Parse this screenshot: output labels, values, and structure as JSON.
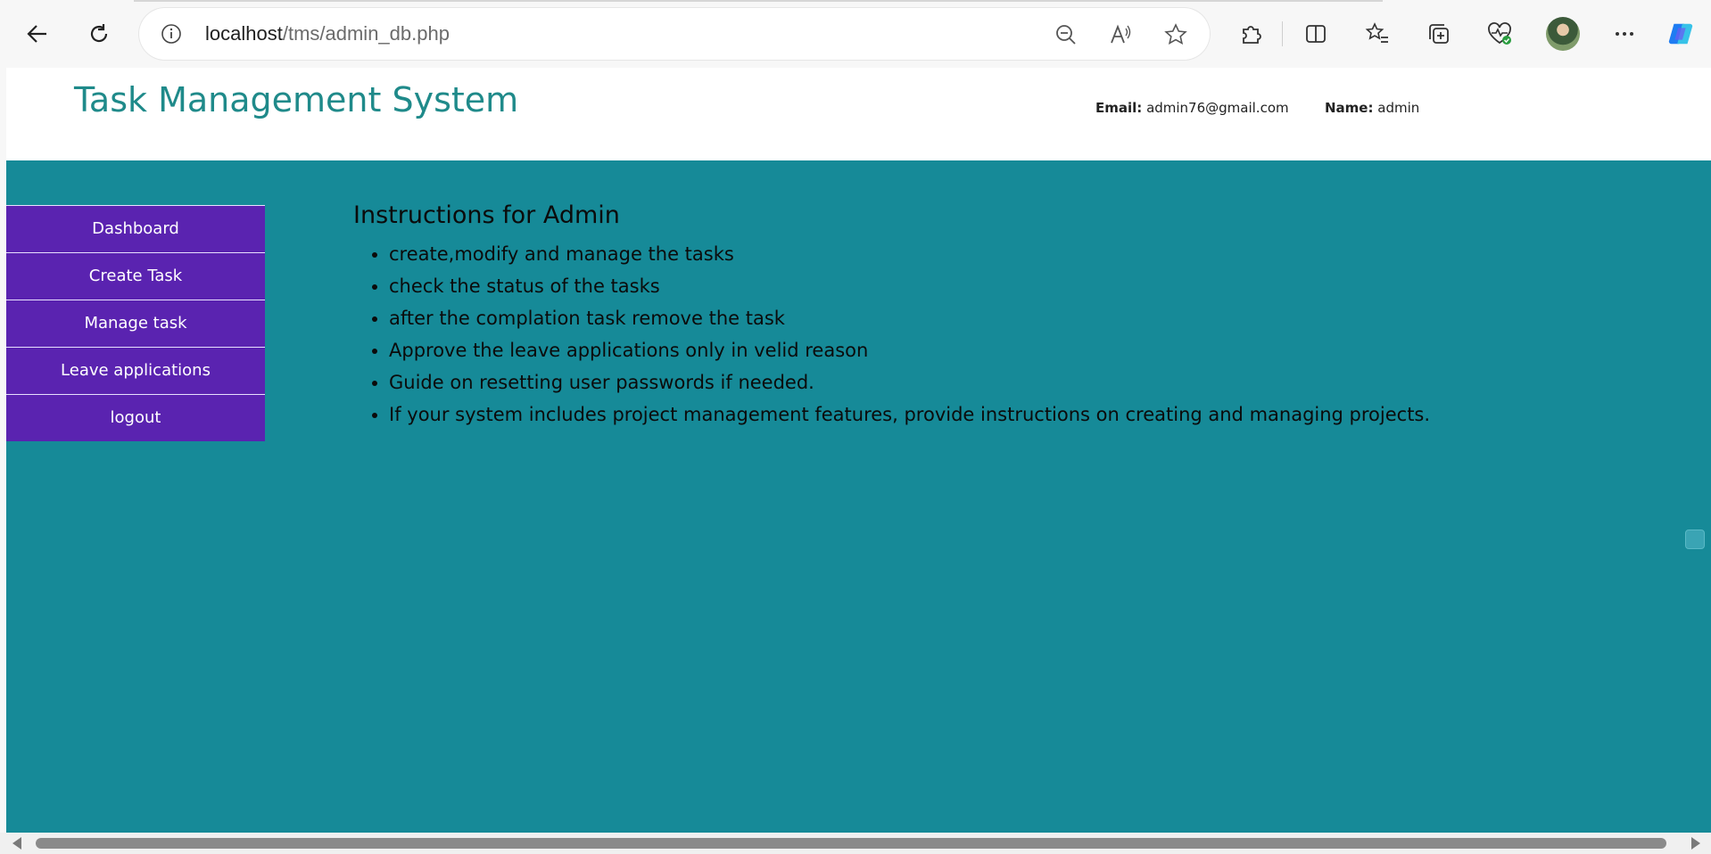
{
  "browser": {
    "url_host": "localhost",
    "url_path": "/tms/admin_db.php",
    "icons": {
      "back": "arrow-left-icon",
      "refresh": "refresh-icon",
      "info": "info-icon",
      "zoom": "zoom-out-icon",
      "read_aloud": "read-aloud-icon",
      "favorite": "star-icon",
      "extensions": "puzzle-icon",
      "split": "split-screen-icon",
      "favorites": "favorites-icon",
      "collections": "collections-icon",
      "health": "browser-essentials-icon",
      "more": "more-icon",
      "copilot": "copilot-icon"
    }
  },
  "header": {
    "title": "Task Management System",
    "email_label": "Email:",
    "email_value": "admin76@gmail.com",
    "name_label": "Name:",
    "name_value": "admin"
  },
  "sidebar": {
    "items": [
      {
        "label": "Dashboard"
      },
      {
        "label": "Create Task"
      },
      {
        "label": "Manage task"
      },
      {
        "label": "Leave applications"
      },
      {
        "label": "logout"
      }
    ]
  },
  "main": {
    "heading": "Instructions for Admin",
    "instructions": [
      "create,modify and manage the tasks",
      "check the status of the tasks",
      "after the complation task remove the task",
      "Approve the leave applications only in velid reason",
      "Guide on resetting user passwords if needed.",
      "If your system includes project management features, provide instructions on creating and managing projects."
    ]
  },
  "colors": {
    "page_background": "#168a98",
    "title": "#1f8a8a",
    "sidebar": "#5a23b0"
  }
}
